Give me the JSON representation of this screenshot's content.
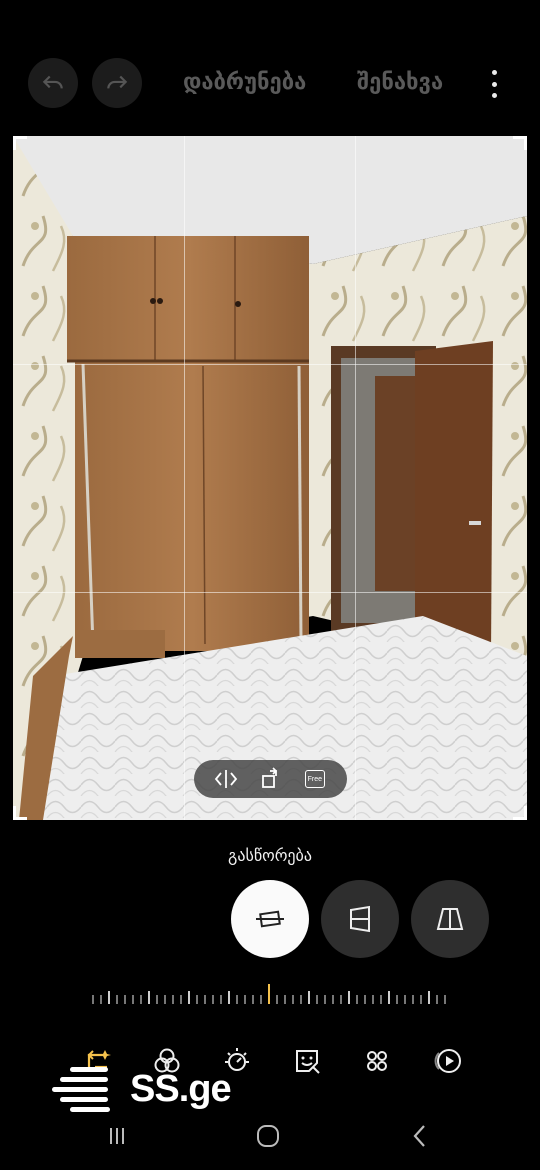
{
  "top_bar": {
    "undo_icon": "undo-icon",
    "redo_icon": "redo-icon",
    "revert_label": "დაბრუნება",
    "save_label": "შენახვა",
    "more_icon": "more-vertical-icon"
  },
  "photo": {
    "description_icon": "bedroom-photo"
  },
  "overlay_pill": {
    "flip_icon": "flip-horizontal-icon",
    "rotate_icon": "rotate-icon",
    "free_label": "Free"
  },
  "mode": {
    "label": "გასწორება",
    "buttons": [
      {
        "icon": "straighten-icon",
        "active": true
      },
      {
        "icon": "vertical-perspective-icon",
        "active": false
      },
      {
        "icon": "horizontal-perspective-icon",
        "active": false
      }
    ]
  },
  "dial": {
    "value": 0,
    "accent": "#f5c24d"
  },
  "toolbar": {
    "items": [
      "transform-icon",
      "filter-icon",
      "brightness-icon",
      "sticker-icon",
      "more-tools-icon",
      "video-icon"
    ]
  },
  "watermark": {
    "text": "SS.ge"
  },
  "navbar": {
    "recents_icon": "recents-icon",
    "home_icon": "home-icon",
    "back_icon": "back-icon"
  }
}
